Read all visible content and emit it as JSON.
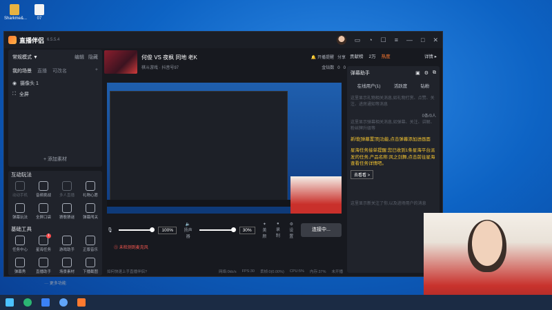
{
  "desktop": {
    "icons": [
      "Sharkme&...",
      "07"
    ]
  },
  "app": {
    "title": "直播伴侣",
    "version": "6.5.5.4"
  },
  "left": {
    "scene": {
      "mode": "常规模式 ▼",
      "edit": "编辑",
      "hide": "隐藏",
      "tabs": [
        "我的场景",
        "直播",
        "可改名"
      ],
      "sources": [
        "摄像头 1",
        "全屏"
      ],
      "add_source": "+ 添加素材"
    },
    "interactive_title": "互动玩法",
    "interactive": [
      "动动手机",
      "音频挑战",
      "多人直播",
      "礼物心愿",
      "弹幕玩法",
      "全屏口袋",
      "猜歌猜谜",
      "弹幕闯关"
    ],
    "basic_title": "基础工具",
    "basic": [
      "任务中心",
      "星海任务",
      "游戏助手",
      "正版音乐",
      "弹幕秀",
      "直播助手",
      "场景素材",
      "下播截图"
    ],
    "badge": "1",
    "more": "··· 更多功能"
  },
  "room": {
    "title": "何俊 VS 夜枫 同地 老K",
    "sub": "棋斗游戏 · 抖音号97",
    "notice": "开播提醒",
    "share": "分享",
    "likes": "0",
    "followers": "0",
    "coin": "金钻数"
  },
  "controls": {
    "mic_pct": "100%",
    "spk_label": "扬声器",
    "spk_pct": "30%",
    "fx": "美颜",
    "rec": "录制",
    "settings": "设置",
    "connect": "连接中..."
  },
  "warning": "未检测到麦克风",
  "status": {
    "help": "如何快速上手直播伴侣?",
    "net": "网络:0kb/s",
    "fps": "FPS:30",
    "drop": "丢帧:0(0.00%)",
    "cpu": "CPU:5%",
    "mem": "内存:37%",
    "rec": "未开播"
  },
  "right": {
    "top": {
      "fans": "贡献榜",
      "count": "2万",
      "heat": "热度",
      "detail": "详情 ▸"
    },
    "danmu": {
      "title": "弹幕助手",
      "tabs": [
        "在线用户(1)",
        "活跃度",
        "钻粉"
      ],
      "tip1": "这里显示礼物相关消息,如礼物打赏、点赞、关注、进房通知等消息",
      "tip2": "这里显示弹幕相关消息,如弹幕、关注、讲解、粉丝牌升级等",
      "ratio": "0条/0人",
      "hl1": "新增[弹幕置顶]功能,点击弹幕添加进画面",
      "hl2": "星海任务接单提醒:您已收到1条星海平台派发的任务,产品名称:风之剑舞,点击前往星海查看任务详情吧。",
      "go": "去看看 >",
      "tip3": "这里显示新关注了你,以及进场用户的消息"
    }
  },
  "taskbar": {
    "icons": [
      "windows-icon",
      "edge-icon",
      "store-icon",
      "settings-icon",
      "live-icon"
    ]
  },
  "colors": {
    "accent": "#ff7a2f",
    "warn": "#ff5a52",
    "highlight": "#f4c430"
  }
}
